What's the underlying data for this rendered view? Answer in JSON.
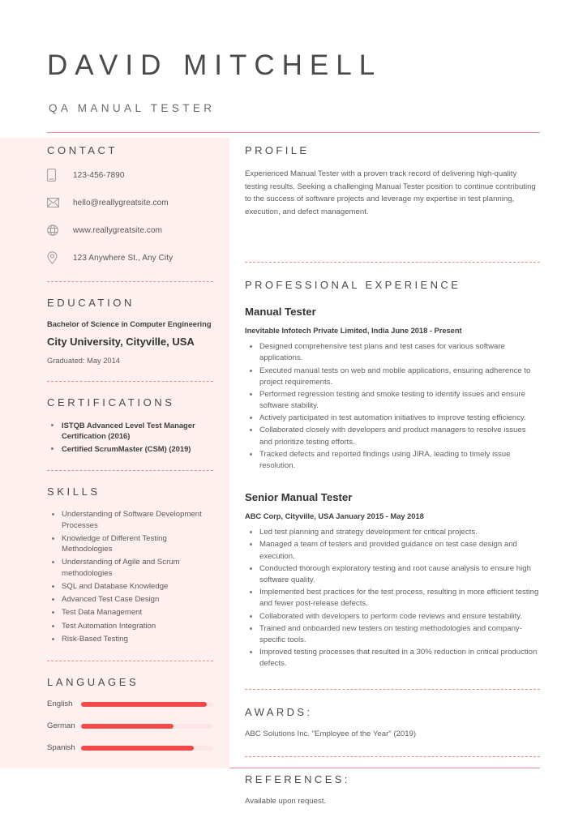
{
  "header": {
    "name": "DAVID MITCHELL",
    "job_title": "QA MANUAL TESTER"
  },
  "theme": {
    "accent_red": "#f44a4a",
    "rule_pink": "#ef8a8a",
    "panel_pink": "#fdf0ef",
    "text_dark": "#4a4a4a",
    "text_body": "#5d5d5d"
  },
  "sidebar": {
    "contact": {
      "title": "CONTACT",
      "items": [
        {
          "icon": "phone-icon",
          "text": "123-456-7890"
        },
        {
          "icon": "envelope-icon",
          "text": "hello@reallygreatsite.com"
        },
        {
          "icon": "globe-icon",
          "text": "www.reallygreatsite.com"
        },
        {
          "icon": "location-pin-icon",
          "text": "123 Anywhere St., Any City"
        }
      ]
    },
    "education": {
      "title": "EDUCATION",
      "degree": "Bachelor of Science in Computer Engineering",
      "school": "City University, Cityville, USA",
      "graduated": "Graduated: May 2014"
    },
    "certifications": {
      "title": "CERTIFICATIONS",
      "items": [
        "ISTQB Advanced Level Test Manager Certification (2016)",
        "Certified ScrumMaster (CSM) (2019)"
      ]
    },
    "skills": {
      "title": "SKILLS",
      "items": [
        "Understanding of Software Development Processes",
        "Knowledge of Different Testing Methodologies",
        "Understanding of Agile and Scrum methodologies",
        "SQL and Database Knowledge",
        "Advanced Test Case Design",
        "Test Data Management",
        "Test Automation Integration",
        "Risk-Based Testing"
      ]
    },
    "languages": {
      "title": "LANGUAGES",
      "items": [
        {
          "name": "English",
          "level": 95
        },
        {
          "name": "German",
          "level": 70
        },
        {
          "name": "Spanish",
          "level": 85
        }
      ]
    }
  },
  "main": {
    "profile": {
      "title": "PROFILE",
      "text": "Experienced Manual Tester with a proven track record of delivering high-quality testing results. Seeking a challenging Manual Tester position to continue contributing to the success of software projects and leverage my expertise in test planning, execution, and defect management."
    },
    "experience": {
      "title": "PROFESSIONAL EXPERIENCE",
      "jobs": [
        {
          "role": "Manual Tester",
          "meta": "Inevitable Infotech Private Limited, India June 2018 - Present",
          "bullets": [
            "Designed comprehensive test plans and test cases for various software applications.",
            "Executed manual tests on web and mobile applications, ensuring adherence to project requirements.",
            "Performed regression testing and smoke testing to identify issues and ensure software stability.",
            "Actively participated in test automation initiatives to improve testing efficiency.",
            "Collaborated closely with developers and product managers to resolve issues and prioritize testing efforts.",
            "Tracked defects and reported findings using JIRA, leading to timely issue resolution."
          ]
        },
        {
          "role": "Senior Manual Tester",
          "meta": "ABC Corp, Cityville, USA January 2015 - May 2018",
          "bullets": [
            "Led test planning and strategy development for critical projects.",
            "Managed a team of testers and provided guidance on test case design and execution.",
            "Conducted thorough exploratory testing and root cause analysis to ensure high software quality.",
            "Implemented best practices for the test process, resulting in more efficient testing and fewer post-release defects.",
            "Collaborated with developers to perform code reviews and ensure testability.",
            "Trained and onboarded new testers on testing methodologies and company-specific tools.",
            "Improved testing processes that resulted in a 30% reduction in critical production defects."
          ]
        }
      ]
    },
    "awards": {
      "title": "AWARDS:",
      "text": "ABC Solutions Inc. \"Employee of the Year\" (2019)"
    },
    "references": {
      "title": "REFERENCES:",
      "text": "Available upon request."
    }
  }
}
